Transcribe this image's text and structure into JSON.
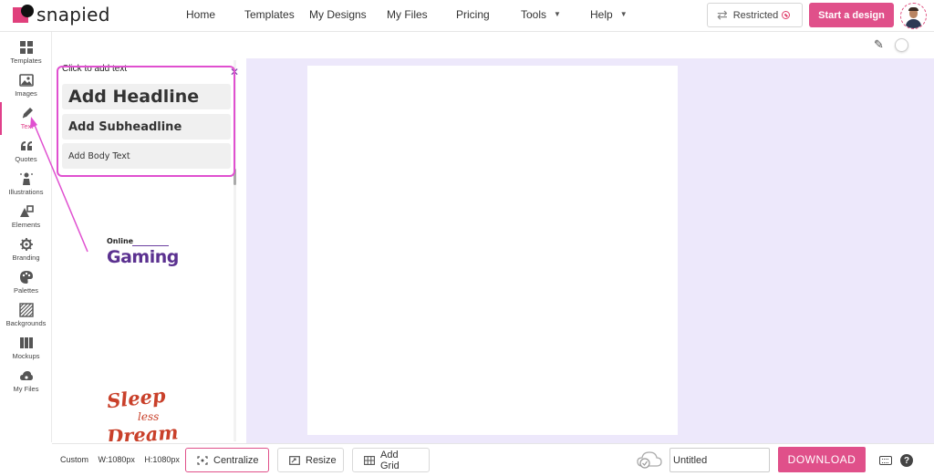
{
  "brand": {
    "name": "snapied"
  },
  "nav": {
    "items": [
      {
        "label": "Home"
      },
      {
        "label": "Templates"
      },
      {
        "label": "My Designs"
      },
      {
        "label": "My Files"
      },
      {
        "label": "Pricing"
      },
      {
        "label": "Tools"
      },
      {
        "label": "Help"
      }
    ],
    "restricted_label": "Restricted",
    "start_label": "Start a design"
  },
  "sidebar": {
    "items": [
      {
        "label": "Templates",
        "icon": "grid-icon"
      },
      {
        "label": "Images",
        "icon": "image-icon"
      },
      {
        "label": "Text",
        "icon": "pen-icon",
        "active": true
      },
      {
        "label": "Quotes",
        "icon": "quote-icon"
      },
      {
        "label": "Illustrations",
        "icon": "illustration-icon"
      },
      {
        "label": "Elements",
        "icon": "shapes-icon"
      },
      {
        "label": "Branding",
        "icon": "gear-icon"
      },
      {
        "label": "Palettes",
        "icon": "palette-icon"
      },
      {
        "label": "Backgrounds",
        "icon": "hatch-icon"
      },
      {
        "label": "Mockups",
        "icon": "columns-icon"
      },
      {
        "label": "My Files",
        "icon": "cloud-icon"
      }
    ]
  },
  "text_panel": {
    "hint": "Click to add text",
    "headline": "Add Headline",
    "subheadline": "Add Subheadline",
    "body": "Add Body Text",
    "samples": [
      {
        "line1": "Online",
        "line2": "Gaming"
      },
      {
        "line1": "Sleep",
        "line2": "less",
        "line3": "Dream"
      }
    ]
  },
  "bottom": {
    "preset": "Custom",
    "width": "W:1080px",
    "height": "H:1080px",
    "centralize_label": "Centralize",
    "resize_label": "Resize",
    "grid_label": "Add Grid",
    "design_name": "Untitled",
    "download_label": "DOWNLOAD",
    "help_glyph": "?"
  },
  "colors": {
    "accent": "#e0508a",
    "workspace": "#ede8fb",
    "annotation": "#e050d0"
  }
}
